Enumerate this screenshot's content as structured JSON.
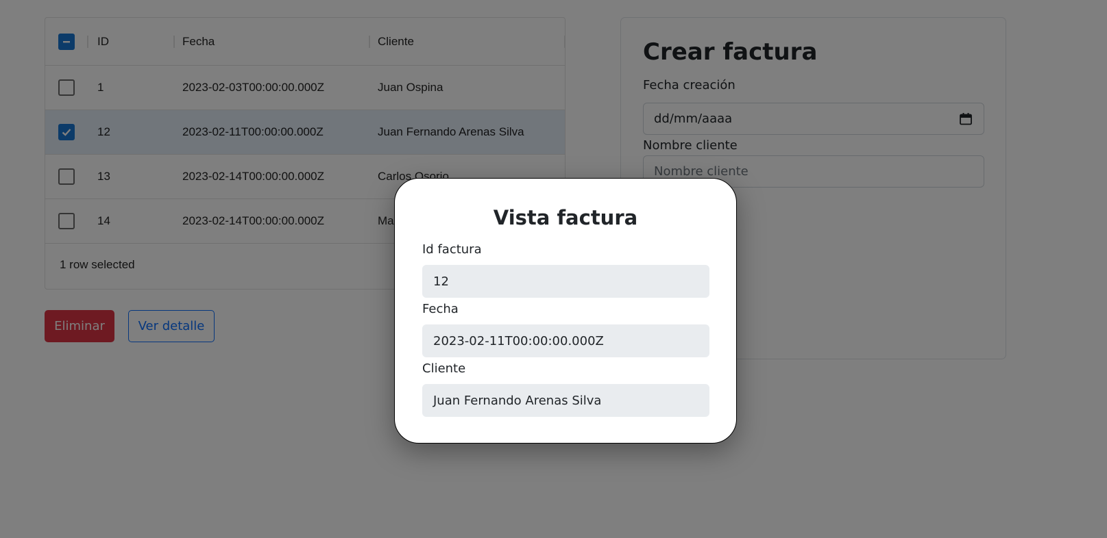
{
  "grid": {
    "columns": {
      "id": "ID",
      "fecha": "Fecha",
      "cliente": "Cliente"
    },
    "rows": [
      {
        "id": "1",
        "fecha": "2023-02-03T00:00:00.000Z",
        "cliente": "Juan Ospina",
        "selected": false
      },
      {
        "id": "12",
        "fecha": "2023-02-11T00:00:00.000Z",
        "cliente": "Juan Fernando Arenas Silva",
        "selected": true
      },
      {
        "id": "13",
        "fecha": "2023-02-14T00:00:00.000Z",
        "cliente": "Carlos Osorio",
        "selected": false
      },
      {
        "id": "14",
        "fecha": "2023-02-14T00:00:00.000Z",
        "cliente": "Ma",
        "selected": false
      }
    ],
    "footer": "1 row selected"
  },
  "actions": {
    "delete_label": "Eliminar",
    "detail_label": "Ver detalle"
  },
  "create_form": {
    "title": "Crear factura",
    "date_label": "Fecha creación",
    "date_placeholder": "dd/mm/aaaa",
    "client_label": "Nombre cliente",
    "client_placeholder": "Nombre cliente"
  },
  "modal": {
    "title": "Vista factura",
    "id_label": "Id factura",
    "id_value": "12",
    "fecha_label": "Fecha",
    "fecha_value": "2023-02-11T00:00:00.000Z",
    "cliente_label": "Cliente",
    "cliente_value": "Juan Fernando Arenas Silva"
  },
  "icons": {
    "calendar": "calendar-icon",
    "checkbox_checked": "check-icon",
    "checkbox_indeterminate": "minus-icon"
  },
  "colors": {
    "accent": "#1976d2",
    "danger": "#dc3545",
    "primary": "#0d6efd",
    "selected_row": "#e3edf7",
    "overlay": "rgba(0,0,0,0.5)"
  }
}
